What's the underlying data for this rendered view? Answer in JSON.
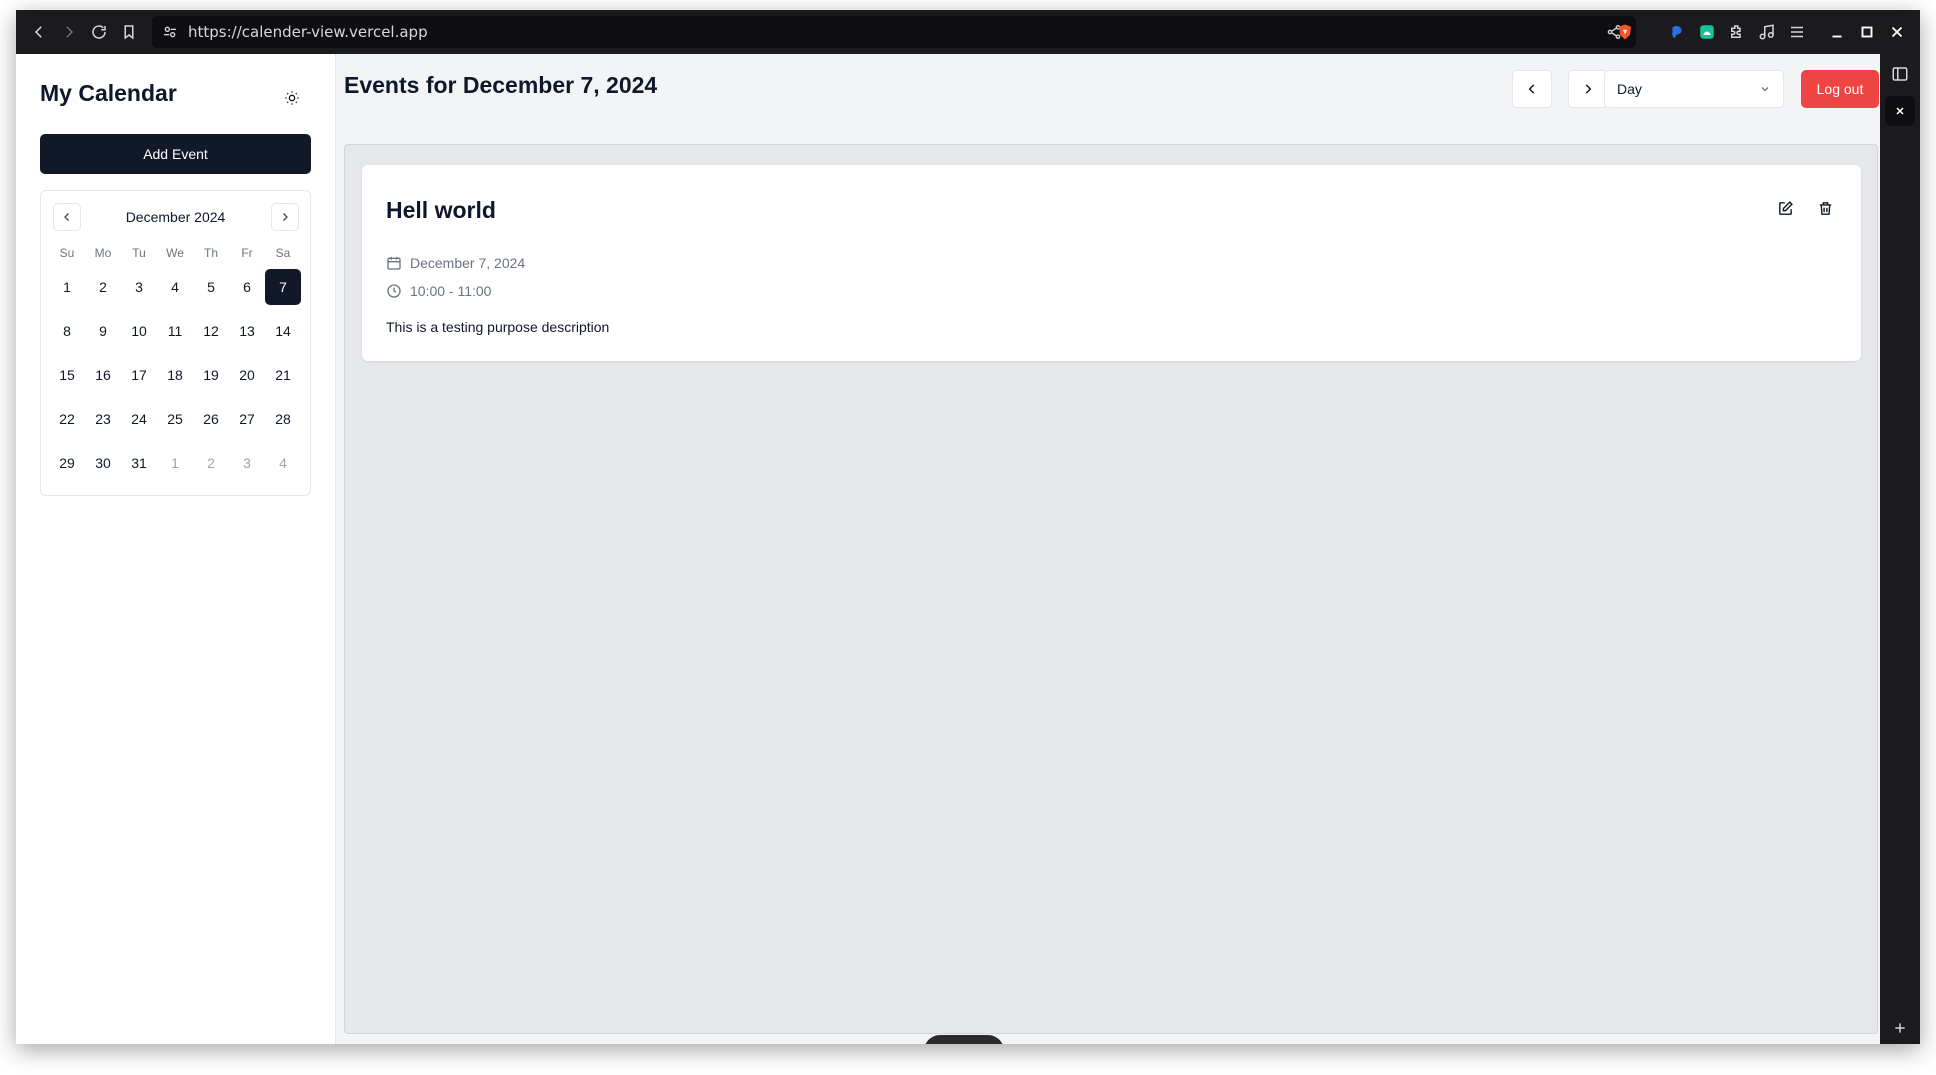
{
  "browser": {
    "url": "https://calender-view.vercel.app",
    "icons": [
      "back-icon",
      "forward-icon",
      "reload-icon",
      "bookmark-icon",
      "site-settings-icon",
      "share-icon",
      "brave-shield-icon",
      "extension-icon",
      "puzzle-icon",
      "music-icon",
      "menu-icon",
      "minimize-icon",
      "maximize-icon",
      "close-icon",
      "sidebar-toggle-icon",
      "plus-icon"
    ]
  },
  "sidebar": {
    "title": "My Calendar",
    "add_event_label": "Add Event",
    "mini_calendar": {
      "month_label": "December 2024",
      "weekdays": [
        "Su",
        "Mo",
        "Tu",
        "We",
        "Th",
        "Fr",
        "Sa"
      ],
      "weeks": [
        [
          "1",
          "2",
          "3",
          "4",
          "5",
          "6",
          "7"
        ],
        [
          "8",
          "9",
          "10",
          "11",
          "12",
          "13",
          "14"
        ],
        [
          "15",
          "16",
          "17",
          "18",
          "19",
          "20",
          "21"
        ],
        [
          "22",
          "23",
          "24",
          "25",
          "26",
          "27",
          "28"
        ],
        [
          "29",
          "30",
          "31",
          "1",
          "2",
          "3",
          "4"
        ]
      ],
      "selected_day": "7"
    }
  },
  "main": {
    "title": "Events for December 7, 2024",
    "view_select_value": "Day",
    "logout_label": "Log out",
    "events": [
      {
        "title": "Hell world",
        "date": "December 7, 2024",
        "time": "10:00 - 11:00",
        "description": "This is a testing purpose description"
      }
    ]
  },
  "colors": {
    "primary": "#111827",
    "danger": "#ef4444",
    "panel": "#e5e7eb",
    "muted_text": "#6b7280"
  }
}
